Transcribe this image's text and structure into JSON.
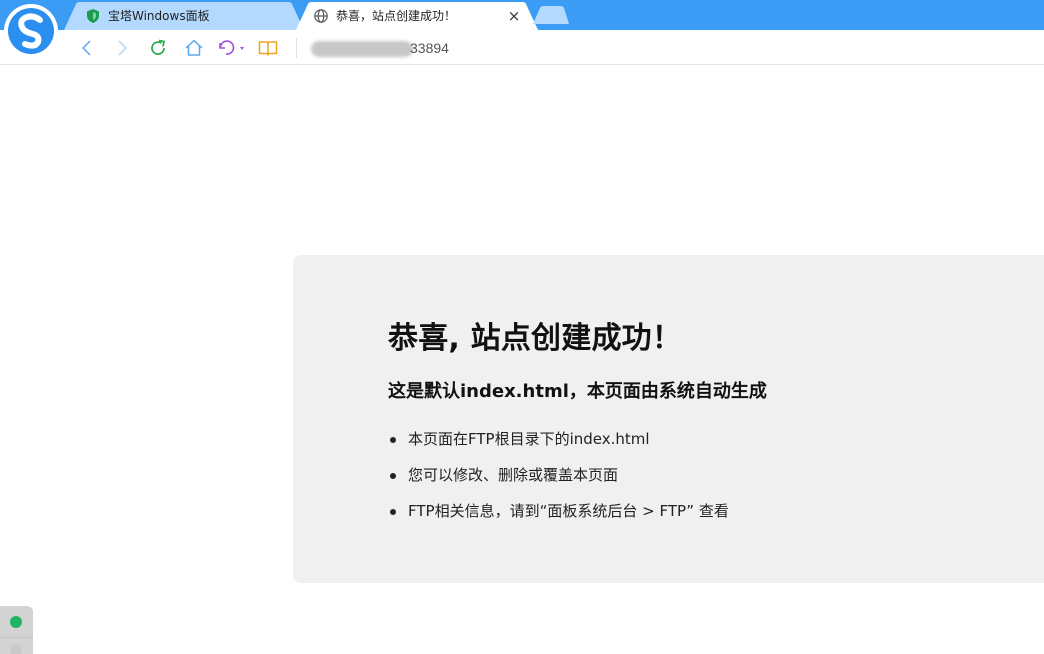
{
  "browser": {
    "tabs": [
      {
        "title": "宝塔Windows面板",
        "icon": "shield-icon",
        "active": false
      },
      {
        "title": "恭喜，站点创建成功！",
        "icon": "globe-icon",
        "active": true,
        "close_label": "×"
      }
    ],
    "address": {
      "url_visible_suffix": "33894"
    },
    "colors": {
      "tab_strip": "#3a9cf4",
      "active_tab": "#ffffff",
      "inactive_tab": "#b3d9ff",
      "refresh": "#27a844",
      "reader": "#f0a31c",
      "undo": "#a84fd6"
    }
  },
  "page": {
    "heading": "恭喜, 站点创建成功！",
    "subheading": "这是默认index.html，本页面由系统自动生成",
    "bullets": [
      "本页面在FTP根目录下的index.html",
      "您可以修改、删除或覆盖本页面",
      "FTP相关信息，请到“面板系统后台 > FTP” 查看"
    ]
  }
}
